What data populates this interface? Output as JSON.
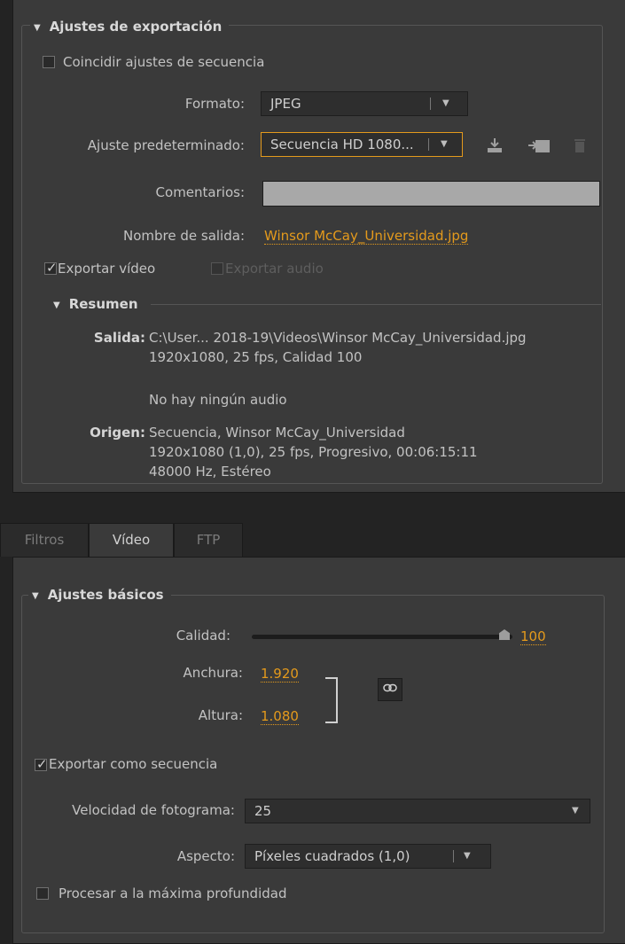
{
  "export_settings": {
    "title": "Ajustes de exportación",
    "match_sequence_label": "Coincidir ajustes de secuencia",
    "format_label": "Formato:",
    "format_value": "JPEG",
    "preset_label": "Ajuste predeterminado:",
    "preset_value": "Secuencia HD 1080...",
    "comments_label": "Comentarios:",
    "comments_value": "",
    "output_name_label": "Nombre de salida:",
    "output_name_value": "Winsor McCay_Universidad.jpg",
    "export_video_label": "Exportar vídeo",
    "export_video_checked": true,
    "export_audio_label": "Exportar audio",
    "export_audio_checked": false,
    "summary": {
      "title": "Resumen",
      "output_label": "Salida:",
      "output_line1": "C:\\User... 2018-19\\Videos\\Winsor McCay_Universidad.jpg",
      "output_line2": "1920x1080, 25 fps, Calidad 100",
      "output_line3": "No hay ningún audio",
      "source_label": "Origen:",
      "source_line1": "Secuencia, Winsor McCay_Universidad",
      "source_line2": "1920x1080 (1,0), 25 fps, Progresivo, 00:06:15:11",
      "source_line3": "48000 Hz, Estéreo"
    }
  },
  "tabs": [
    {
      "label": "Filtros",
      "active": false
    },
    {
      "label": "Vídeo",
      "active": true
    },
    {
      "label": "FTP",
      "active": false
    }
  ],
  "basic_settings": {
    "title": "Ajustes básicos",
    "quality_label": "Calidad:",
    "quality_value": "100",
    "quality_fraction": 1.0,
    "width_label": "Anchura:",
    "width_value": "1.920",
    "height_label": "Altura:",
    "height_value": "1.080",
    "export_as_sequence_label": "Exportar como secuencia",
    "export_as_sequence_checked": true,
    "frame_rate_label": "Velocidad de fotograma:",
    "frame_rate_value": "25",
    "aspect_label": "Aspecto:",
    "aspect_value": "Píxeles cuadrados (1,0)",
    "max_depth_label": "Procesar a la máxima profundidad",
    "max_depth_checked": false
  },
  "icons": {
    "save_preset": "save-preset-icon",
    "import_preset": "import-preset-icon",
    "delete_preset": "trash-icon",
    "link": "chain-link-icon",
    "accent_color": "#e49a1c"
  }
}
